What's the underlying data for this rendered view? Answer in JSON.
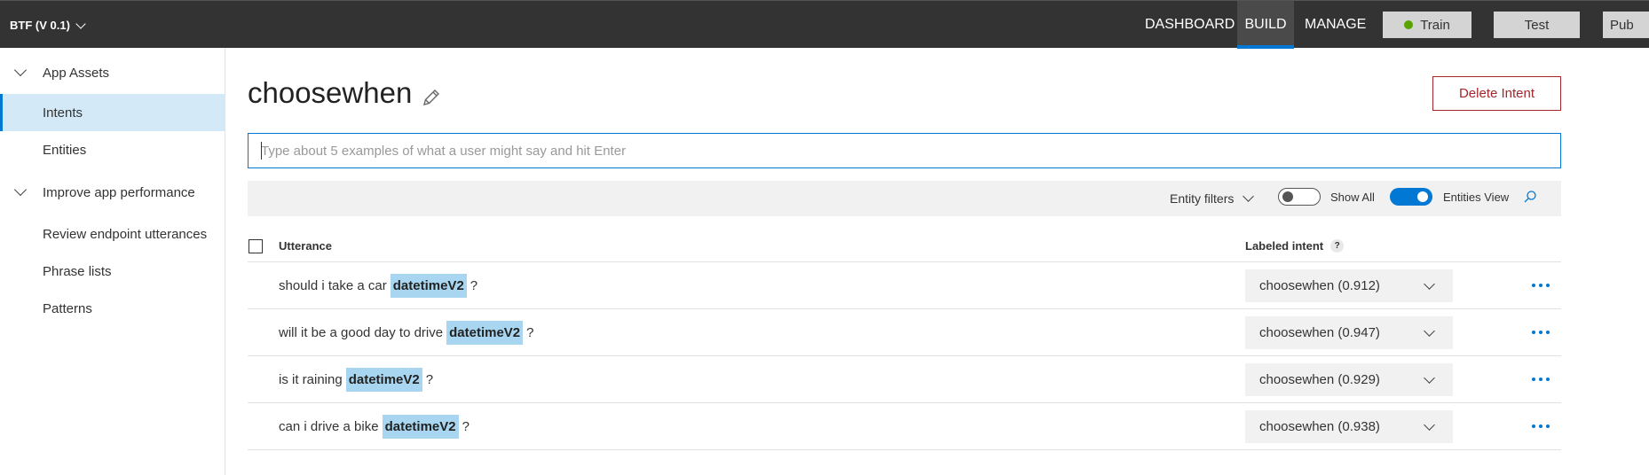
{
  "topbar": {
    "app_name": "BTF (V 0.1)",
    "nav": [
      "DASHBOARD",
      "BUILD",
      "MANAGE"
    ],
    "active_nav": "BUILD",
    "train_label": "Train",
    "test_label": "Test",
    "publish_label": "Pub",
    "train_status_color": "#57a300"
  },
  "sidebar": {
    "sections": [
      {
        "label": "App Assets",
        "expanded": true
      },
      {
        "label": "Improve app performance",
        "expanded": true
      }
    ],
    "items": [
      {
        "label": "Intents",
        "selected": true
      },
      {
        "label": "Entities",
        "selected": false
      },
      {
        "label": "Review endpoint utterances",
        "selected": false
      },
      {
        "label": "Phrase lists",
        "selected": false
      },
      {
        "label": "Patterns",
        "selected": false
      }
    ]
  },
  "main": {
    "title": "choosewhen",
    "delete_label": "Delete Intent",
    "input_placeholder": "Type about 5 examples of what a user might say and hit Enter",
    "input_value": "",
    "filters": {
      "entity_filters_label": "Entity filters",
      "show_all_label": "Show All",
      "show_all_on": false,
      "entities_view_label": "Entities View",
      "entities_view_on": true
    },
    "table": {
      "col_utterance": "Utterance",
      "col_labeled": "Labeled intent",
      "help": "?",
      "rows": [
        {
          "before": "should i take a car",
          "entity": "datetimeV2",
          "after": "?",
          "intent": "choosewhen (0.912)"
        },
        {
          "before": "will it be a good day to drive",
          "entity": "datetimeV2",
          "after": "?",
          "intent": "choosewhen (0.947)"
        },
        {
          "before": "is it raining",
          "entity": "datetimeV2",
          "after": "?",
          "intent": "choosewhen (0.929)"
        },
        {
          "before": "can i drive a bike",
          "entity": "datetimeV2",
          "after": "?",
          "intent": "choosewhen (0.938)"
        }
      ]
    }
  },
  "colors": {
    "topbar_bg": "#333333",
    "accent": "#0078d4",
    "delete": "#a4262c",
    "entity_chip": "#a8d6f0",
    "selected_item_bg": "#d4e9f7"
  }
}
